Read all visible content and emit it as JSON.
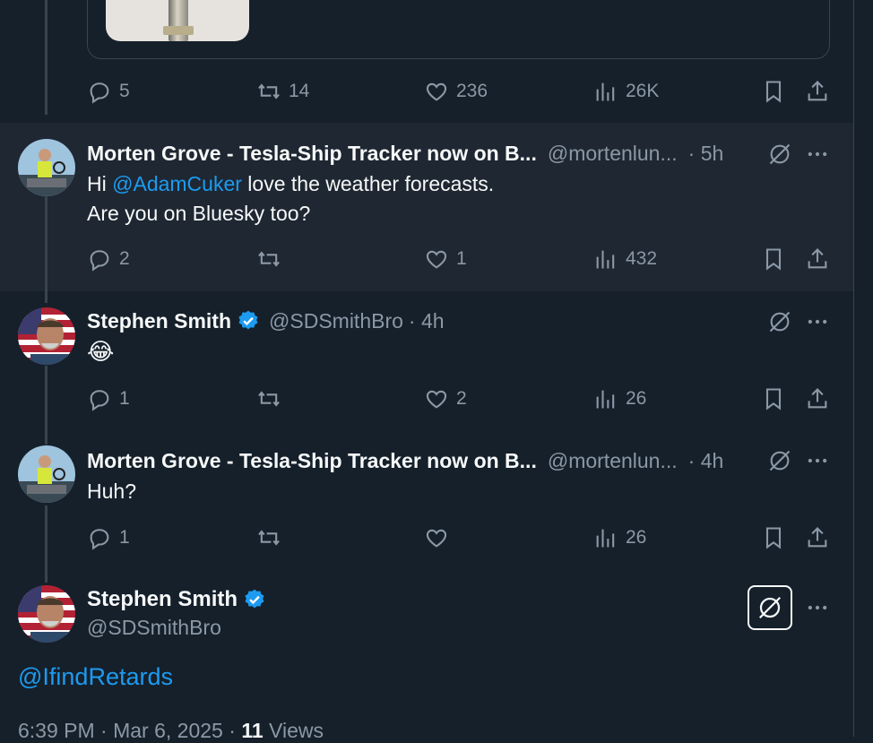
{
  "top_tweet": {
    "actions": {
      "replies": "5",
      "reposts": "14",
      "likes": "236",
      "views": "26K"
    }
  },
  "replies": [
    {
      "name": "Morten Grove - Tesla-Ship Tracker now on B...",
      "handle": "@mortenlun...",
      "time": "· 5h",
      "text_line1_prefix": "Hi ",
      "text_line1_mention": "@AdamCuker",
      "text_line1_suffix": " love the weather forecasts.",
      "text_line2": "Are you on Bluesky too?",
      "actions": {
        "replies": "2",
        "reposts": "",
        "likes": "1",
        "views": "432"
      }
    },
    {
      "name": "Stephen Smith",
      "handle": "@SDSmithBro",
      "time": "· 4h",
      "text": "😂",
      "actions": {
        "replies": "1",
        "reposts": "",
        "likes": "2",
        "views": "26"
      }
    },
    {
      "name": "Morten Grove - Tesla-Ship Tracker now on B...",
      "handle": "@mortenlun...",
      "time": "· 4h",
      "text": "Huh?",
      "actions": {
        "replies": "1",
        "reposts": "",
        "likes": "",
        "views": "26"
      }
    }
  ],
  "main_tweet": {
    "name": "Stephen Smith",
    "handle": "@SDSmithBro",
    "text": "@IfindRetards",
    "time": "6:39 PM",
    "date": "Mar 6, 2025",
    "views_count": "11",
    "views_label": "Views"
  },
  "colors": {
    "background": "#15202b",
    "accent": "#1d9bf0",
    "muted": "#8b98a5",
    "highlight_row": "#1e2732"
  }
}
